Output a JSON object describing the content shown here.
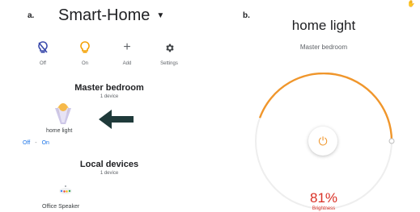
{
  "panel_a": {
    "label": "a.",
    "home_name": "Smart-Home",
    "quick_actions": [
      {
        "label": "Off",
        "icon": "bulb-off-icon"
      },
      {
        "label": "On",
        "icon": "bulb-on-icon"
      },
      {
        "label": "Add",
        "icon": "plus-icon"
      },
      {
        "label": "Settings",
        "icon": "gear-icon"
      }
    ],
    "room": {
      "name": "Master bedroom",
      "device_count": "1 device"
    },
    "device": {
      "name": "home light",
      "off_label": "Off",
      "separator": "-",
      "on_label": "On"
    },
    "local": {
      "title": "Local devices",
      "device_count": "1 device",
      "device_name": "Office Speaker"
    }
  },
  "panel_b": {
    "label": "b.",
    "device_title": "home light",
    "room": "Master bedroom",
    "brightness_value": "81%",
    "brightness_label": "Brightness",
    "brightness_fraction": 0.81
  },
  "colors": {
    "accent": "#f0962b",
    "blue": "#1a73e8",
    "indigo": "#3949ab",
    "red": "#d93025",
    "arrow": "#1f3a3a"
  }
}
